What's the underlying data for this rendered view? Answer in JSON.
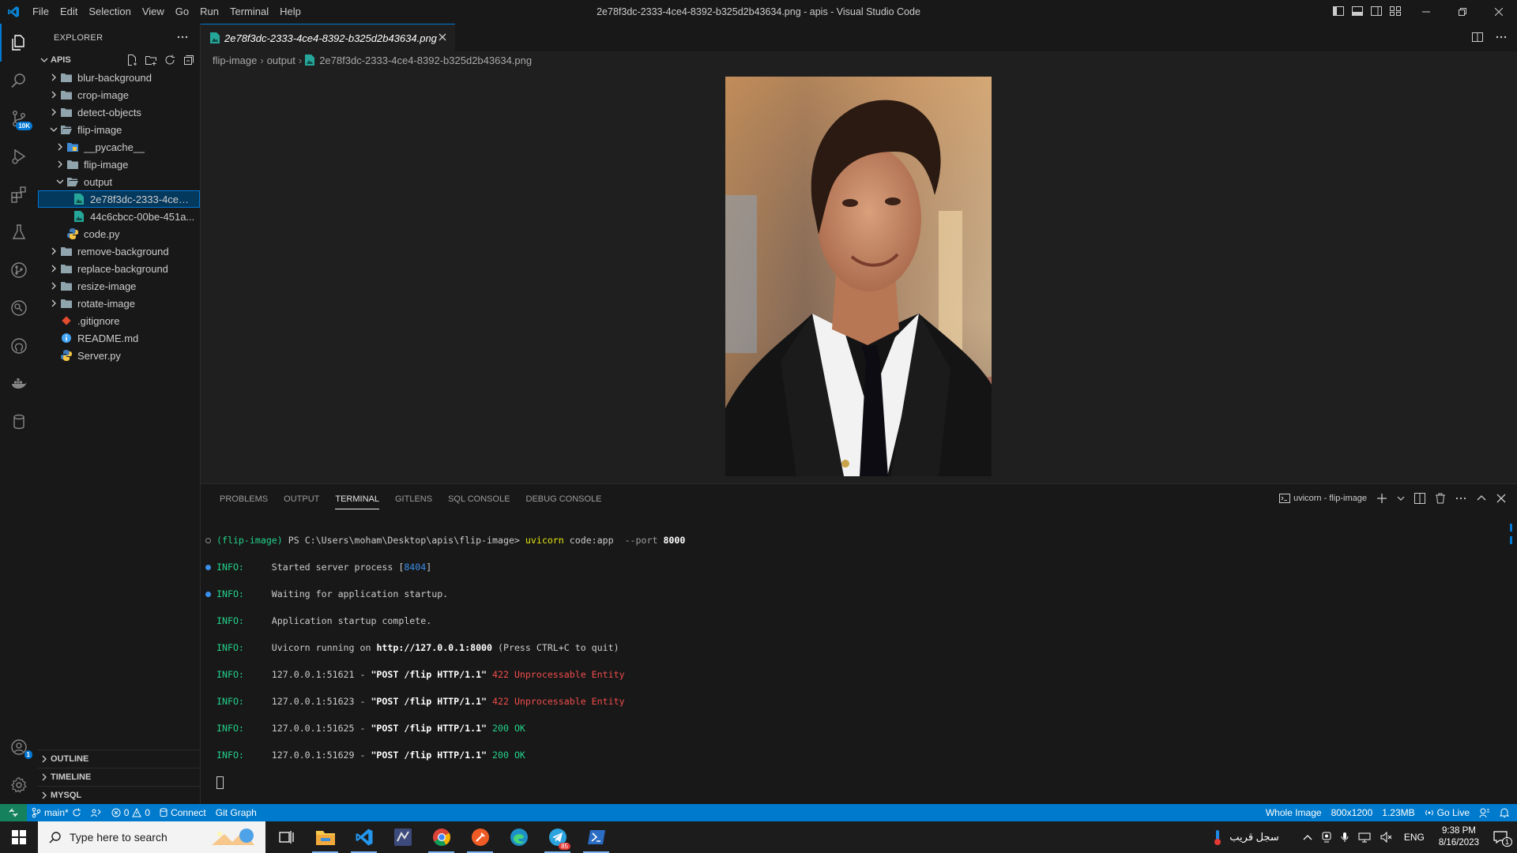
{
  "window": {
    "title": "2e78f3dc-2333-4ce4-8392-b325d2b43634.png - apis - Visual Studio Code",
    "menu": [
      "File",
      "Edit",
      "Selection",
      "View",
      "Go",
      "Run",
      "Terminal",
      "Help"
    ]
  },
  "activity_bar": {
    "scm_badge": "10K",
    "accounts_badge": "1"
  },
  "explorer": {
    "header": "EXPLORER",
    "root": "APIS",
    "tree": [
      {
        "label": "blur-background"
      },
      {
        "label": "crop-image"
      },
      {
        "label": "detect-objects"
      },
      {
        "label": "flip-image"
      },
      {
        "label": "__pycache__"
      },
      {
        "label": "flip-image"
      },
      {
        "label": "output"
      },
      {
        "label": "2e78f3dc-2333-4ce4-8392-b325d2b43634.png"
      },
      {
        "label": "44c6cbcc-00be-451a..."
      },
      {
        "label": "code.py"
      },
      {
        "label": "remove-background"
      },
      {
        "label": "replace-background"
      },
      {
        "label": "resize-image"
      },
      {
        "label": "rotate-image"
      },
      {
        "label": ".gitignore"
      },
      {
        "label": "README.md"
      },
      {
        "label": "Server.py"
      }
    ],
    "bottom_sections": [
      "OUTLINE",
      "TIMELINE",
      "MYSQL"
    ]
  },
  "editor": {
    "tab_label": "2e78f3dc-2333-4ce4-8392-b325d2b43634.png",
    "breadcrumb": [
      "flip-image",
      "output",
      "2e78f3dc-2333-4ce4-8392-b325d2b43634.png"
    ]
  },
  "panel": {
    "tabs": [
      "PROBLEMS",
      "OUTPUT",
      "TERMINAL",
      "GITLENS",
      "SQL CONSOLE",
      "DEBUG CONSOLE"
    ],
    "active_tab": "TERMINAL",
    "terminal_name": "uvicorn - flip-image",
    "terminal": {
      "prompt_env": "(flip-image)",
      "prompt_path": "PS C:\\Users\\moham\\Desktop\\apis\\flip-image>",
      "command": "uvicorn",
      "command_args": "code:app",
      "command_flag": "--port",
      "command_port": "8000",
      "lines": [
        {
          "level": "INFO:",
          "pre": "     Started server process [",
          "pid": "8404",
          "post": "]"
        },
        {
          "level": "INFO:",
          "text": "     Waiting for application startup."
        },
        {
          "level": "INFO:",
          "text": "     Application startup complete."
        },
        {
          "level": "INFO:",
          "pre": "     Uvicorn running on ",
          "url": "http://127.0.0.1:8000",
          "post": " (Press CTRL+C to quit)"
        },
        {
          "level": "INFO:",
          "client": "     127.0.0.1:51621 - ",
          "request": "\"POST /flip HTTP/1.1\"",
          "status": " 422 Unprocessable Entity"
        },
        {
          "level": "INFO:",
          "client": "     127.0.0.1:51623 - ",
          "request": "\"POST /flip HTTP/1.1\"",
          "status": " 422 Unprocessable Entity"
        },
        {
          "level": "INFO:",
          "client": "     127.0.0.1:51625 - ",
          "request": "\"POST /flip HTTP/1.1\"",
          "status": " 200 OK"
        },
        {
          "level": "INFO:",
          "client": "     127.0.0.1:51629 - ",
          "request": "\"POST /flip HTTP/1.1\"",
          "status": " 200 OK"
        }
      ]
    }
  },
  "statusbar": {
    "branch": "main*",
    "errors": "0",
    "warnings": "0",
    "connect": "Connect",
    "git_graph": "Git Graph",
    "image_scope": "Whole Image",
    "dimensions": "800x1200",
    "file_size": "1.23MB",
    "go_live": "Go Live"
  },
  "taskbar": {
    "search_placeholder": "Type here to search",
    "weather_text": "سجل قريب",
    "language": "ENG",
    "time": "9:38 PM",
    "date": "8/16/2023",
    "telegram_badge": "85",
    "notification_count": "1"
  },
  "colors": {
    "accent": "#0078d4",
    "statusbar": "#007acc",
    "terminal_green": "#23d18b",
    "terminal_yellow": "#e5e510",
    "terminal_red": "#f14c4c"
  }
}
